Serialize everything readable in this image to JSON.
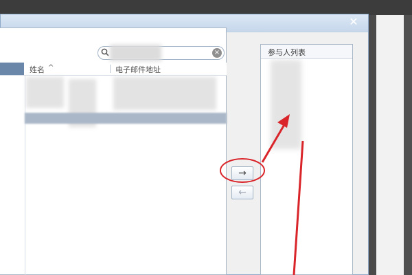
{
  "dialog": {
    "close_label": "✕"
  },
  "search": {
    "value": "",
    "placeholder": "",
    "clear_label": "×"
  },
  "contacts_table": {
    "columns": [
      "姓名",
      "电子邮件地址"
    ],
    "sort_indicator": "^"
  },
  "transfer": {
    "add_label": "→",
    "remove_label": "←"
  },
  "participants": {
    "title": "参与人列表"
  },
  "colors": {
    "annotation_red": "#d9252a",
    "dialog_blue": "#c4d5e8",
    "header_accent": "#6a86a9"
  }
}
